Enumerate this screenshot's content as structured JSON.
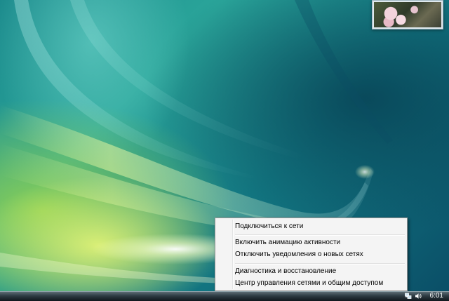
{
  "desktop": {
    "photo_gadget_icon": "photo-thumbnail"
  },
  "context_menu": {
    "items": [
      {
        "label": "Подключиться к сети"
      },
      {
        "label": "Включить анимацию активности"
      },
      {
        "label": "Отключить уведомления о новых сетях"
      },
      {
        "label": "Диагностика и восстановление"
      },
      {
        "label": "Центр управления сетями и общим доступом"
      }
    ]
  },
  "taskbar": {
    "tray_icons": [
      "network-icon",
      "volume-icon"
    ],
    "clock": "6:01"
  },
  "colors": {
    "menu_background": "#f4f4f4",
    "menu_border": "#979797",
    "taskbar": "#1d2a31"
  }
}
